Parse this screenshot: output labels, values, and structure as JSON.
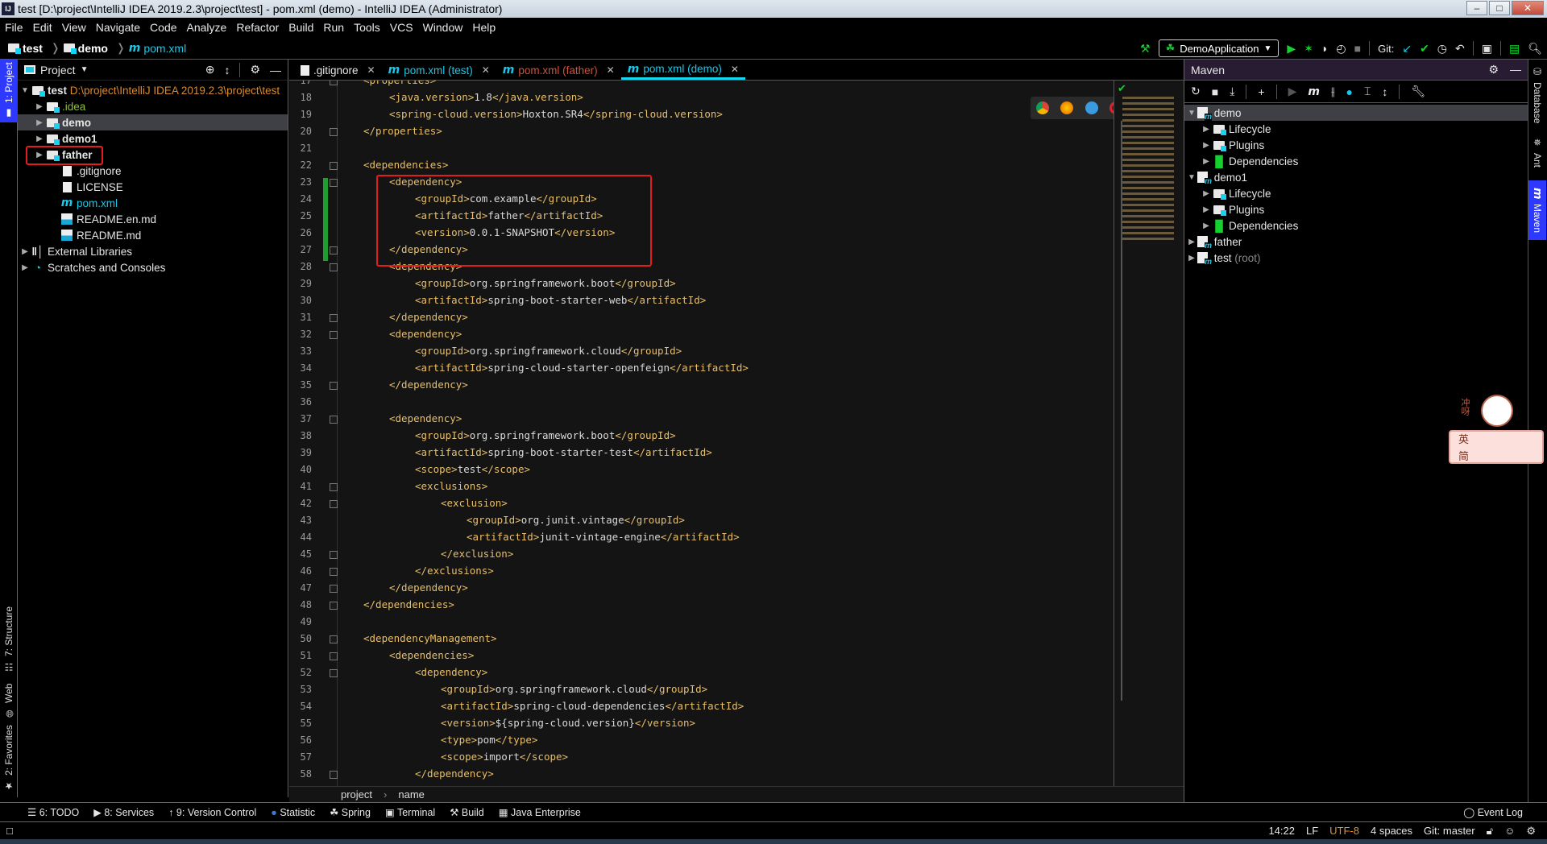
{
  "window": {
    "title": "test [D:\\project\\IntelliJ IDEA 2019.2.3\\project\\test] - pom.xml (demo) - IntelliJ IDEA (Administrator)",
    "app_icon": "IJ",
    "controls": [
      "minimize",
      "maximize",
      "close"
    ]
  },
  "menu": [
    "File",
    "Edit",
    "View",
    "Navigate",
    "Code",
    "Analyze",
    "Refactor",
    "Build",
    "Run",
    "Tools",
    "VCS",
    "Window",
    "Help"
  ],
  "navbar": {
    "crumbs": [
      "test",
      "demo",
      "pom.xml"
    ]
  },
  "toolbar": {
    "run_config": "DemoApplication",
    "git_label": "Git:"
  },
  "left_stripe": {
    "top": "1: Project",
    "bottom": [
      "7: Structure",
      "Web",
      "2: Favorites"
    ]
  },
  "project_panel": {
    "title": "Project",
    "tree": [
      {
        "label": "test",
        "extra": "D:\\project\\IntelliJ IDEA 2019.2.3\\project\\test",
        "depth": 0,
        "expanded": true,
        "kind": "module",
        "bold": true
      },
      {
        "label": ".idea",
        "depth": 1,
        "kind": "folder",
        "color": "#8fbf3f"
      },
      {
        "label": "demo",
        "depth": 1,
        "kind": "module",
        "bold": true,
        "selected": true
      },
      {
        "label": "demo1",
        "depth": 1,
        "kind": "module",
        "bold": true
      },
      {
        "label": "father",
        "depth": 1,
        "kind": "module",
        "bold": true,
        "highlighted": true
      },
      {
        "label": ".gitignore",
        "depth": 2,
        "kind": "gitignore"
      },
      {
        "label": "LICENSE",
        "depth": 2,
        "kind": "text"
      },
      {
        "label": "pom.xml",
        "depth": 2,
        "kind": "maven",
        "color": "#17c8e8"
      },
      {
        "label": "README.en.md",
        "depth": 2,
        "kind": "markdown"
      },
      {
        "label": "README.md",
        "depth": 2,
        "kind": "markdown"
      },
      {
        "label": "External Libraries",
        "depth": 0,
        "kind": "libraries"
      },
      {
        "label": "Scratches and Consoles",
        "depth": 0,
        "kind": "scratches"
      }
    ]
  },
  "editor_tabs": [
    {
      "label": ".gitignore",
      "icon": "gitignore",
      "color": "#e6e6e6"
    },
    {
      "label": "pom.xml (test)",
      "icon": "maven",
      "color": "#17c8e8"
    },
    {
      "label": "pom.xml (father)",
      "icon": "maven",
      "color": "#d0503a"
    },
    {
      "label": "pom.xml (demo)",
      "icon": "maven",
      "color": "#17c8e8",
      "active": true
    }
  ],
  "editor": {
    "lines": [
      {
        "n": 17,
        "indent": 1,
        "text": "<properties>"
      },
      {
        "n": 18,
        "indent": 2,
        "text": "<java.version>1.8</java.version>"
      },
      {
        "n": 19,
        "indent": 2,
        "text": "<spring-cloud.version>Hoxton.SR4</spring-cloud.version>"
      },
      {
        "n": 20,
        "indent": 1,
        "text": "</properties>"
      },
      {
        "n": 21,
        "indent": 0,
        "text": ""
      },
      {
        "n": 22,
        "indent": 1,
        "text": "<dependencies>"
      },
      {
        "n": 23,
        "indent": 2,
        "text": "<dependency>"
      },
      {
        "n": 24,
        "indent": 3,
        "text": "<groupId>com.example</groupId>"
      },
      {
        "n": 25,
        "indent": 3,
        "text": "<artifactId>father</artifactId>"
      },
      {
        "n": 26,
        "indent": 3,
        "text": "<version>0.0.1-SNAPSHOT</version>"
      },
      {
        "n": 27,
        "indent": 2,
        "text": "</dependency>"
      },
      {
        "n": 28,
        "indent": 2,
        "text": "<dependency>"
      },
      {
        "n": 29,
        "indent": 3,
        "text": "<groupId>org.springframework.boot</groupId>"
      },
      {
        "n": 30,
        "indent": 3,
        "text": "<artifactId>spring-boot-starter-web</artifactId>"
      },
      {
        "n": 31,
        "indent": 2,
        "text": "</dependency>"
      },
      {
        "n": 32,
        "indent": 2,
        "text": "<dependency>"
      },
      {
        "n": 33,
        "indent": 3,
        "text": "<groupId>org.springframework.cloud</groupId>"
      },
      {
        "n": 34,
        "indent": 3,
        "text": "<artifactId>spring-cloud-starter-openfeign</artifactId>"
      },
      {
        "n": 35,
        "indent": 2,
        "text": "</dependency>"
      },
      {
        "n": 36,
        "indent": 0,
        "text": ""
      },
      {
        "n": 37,
        "indent": 2,
        "text": "<dependency>"
      },
      {
        "n": 38,
        "indent": 3,
        "text": "<groupId>org.springframework.boot</groupId>"
      },
      {
        "n": 39,
        "indent": 3,
        "text": "<artifactId>spring-boot-starter-test</artifactId>"
      },
      {
        "n": 40,
        "indent": 3,
        "text": "<scope>test</scope>"
      },
      {
        "n": 41,
        "indent": 3,
        "text": "<exclusions>"
      },
      {
        "n": 42,
        "indent": 4,
        "text": "<exclusion>"
      },
      {
        "n": 43,
        "indent": 5,
        "text": "<groupId>org.junit.vintage</groupId>"
      },
      {
        "n": 44,
        "indent": 5,
        "text": "<artifactId>junit-vintage-engine</artifactId>"
      },
      {
        "n": 45,
        "indent": 4,
        "text": "</exclusion>"
      },
      {
        "n": 46,
        "indent": 3,
        "text": "</exclusions>"
      },
      {
        "n": 47,
        "indent": 2,
        "text": "</dependency>"
      },
      {
        "n": 48,
        "indent": 1,
        "text": "</dependencies>"
      },
      {
        "n": 49,
        "indent": 0,
        "text": ""
      },
      {
        "n": 50,
        "indent": 1,
        "text": "<dependencyManagement>"
      },
      {
        "n": 51,
        "indent": 2,
        "text": "<dependencies>"
      },
      {
        "n": 52,
        "indent": 3,
        "text": "<dependency>"
      },
      {
        "n": 53,
        "indent": 4,
        "text": "<groupId>org.springframework.cloud</groupId>"
      },
      {
        "n": 54,
        "indent": 4,
        "text": "<artifactId>spring-cloud-dependencies</artifactId>"
      },
      {
        "n": 55,
        "indent": 4,
        "text": "<version>${spring-cloud.version}</version>"
      },
      {
        "n": 56,
        "indent": 4,
        "text": "<type>pom</type>"
      },
      {
        "n": 57,
        "indent": 4,
        "text": "<scope>import</scope>"
      },
      {
        "n": 58,
        "indent": 3,
        "text": "</dependency>"
      }
    ],
    "breadcrumb": [
      "project",
      "name"
    ],
    "browser_icons": [
      "chrome",
      "firefox",
      "safari",
      "opera",
      "internet-explorer",
      "edge"
    ]
  },
  "maven_panel": {
    "title": "Maven",
    "tree": [
      {
        "label": "demo",
        "depth": 0,
        "kind": "project",
        "expanded": true,
        "selected": true
      },
      {
        "label": "Lifecycle",
        "depth": 1,
        "kind": "lifecycle"
      },
      {
        "label": "Plugins",
        "depth": 1,
        "kind": "plugins"
      },
      {
        "label": "Dependencies",
        "depth": 1,
        "kind": "dependencies"
      },
      {
        "label": "demo1",
        "depth": 0,
        "kind": "project",
        "expanded": true
      },
      {
        "label": "Lifecycle",
        "depth": 1,
        "kind": "lifecycle"
      },
      {
        "label": "Plugins",
        "depth": 1,
        "kind": "plugins"
      },
      {
        "label": "Dependencies",
        "depth": 1,
        "kind": "dependencies"
      },
      {
        "label": "father",
        "depth": 0,
        "kind": "project"
      },
      {
        "label": "test",
        "suffix": "(root)",
        "depth": 0,
        "kind": "project"
      }
    ]
  },
  "right_stripe": [
    "Database",
    "Ant",
    "Maven"
  ],
  "bottom_tools": [
    "6: TODO",
    "8: Services",
    "9: Version Control",
    "Statistic",
    "Spring",
    "Terminal",
    "Build",
    "Java Enterprise"
  ],
  "event_log": "Event Log",
  "status": {
    "position": "14:22",
    "line_sep": "LF",
    "encoding": "UTF-8",
    "indent": "4 spaces",
    "git": "Git: master"
  },
  "sticker": {
    "text1": "冲呀",
    "text2": "英",
    "text3": "简"
  },
  "colors": {
    "accent": "#17c8e8",
    "tag": "#e8bf6a",
    "highlight_box": "#e51c1c",
    "added_lines": "#1e9e2e",
    "encoding": "#e0902a"
  }
}
